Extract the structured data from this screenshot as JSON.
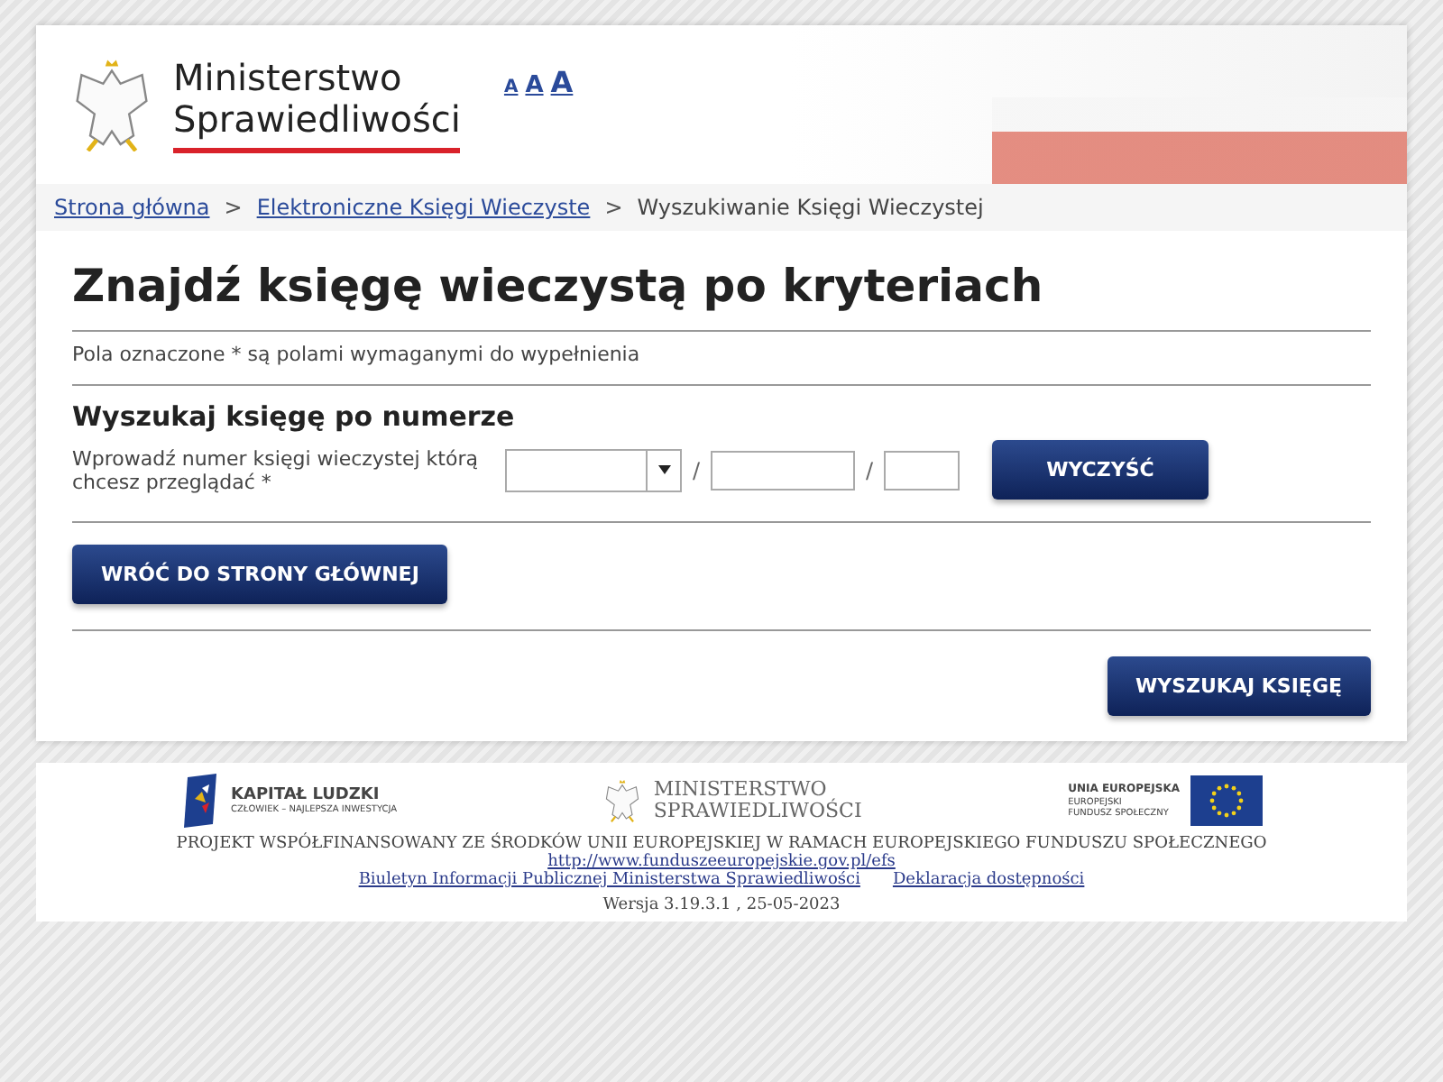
{
  "header": {
    "logo_line_1": "Ministerstwo",
    "logo_line_2": "Sprawiedliwości",
    "font_sizes": [
      "A",
      "A",
      "A"
    ]
  },
  "breadcrumb": [
    {
      "label": "Strona główna",
      "kind": "link"
    },
    {
      "label": "Elektroniczne Księgi Wieczyste",
      "kind": "link"
    },
    {
      "label": "Wyszukiwanie Księgi Wieczystej",
      "kind": "current"
    }
  ],
  "breadcrumb_separator": ">",
  "title": "Znajdź księgę wieczystą po kryteriach",
  "required_note": "Pola oznaczone * są polami wymaganymi do wypełnienia",
  "section": {
    "title": "Wyszukaj księgę po numerze",
    "label": "Wprowadź numer księgi wieczystej którą chcesz przeglądać *",
    "separator": "/",
    "clear_button": "WYCZYŚĆ"
  },
  "back_button": "WRÓĆ DO STRONY GŁÓWNEJ",
  "search_button": "WYSZUKAJ KSIĘGĘ",
  "footer": {
    "kl_title": "KAPITAŁ LUDZKI",
    "kl_subtitle": "CZŁOWIEK – NAJLEPSZA INWESTYCJA",
    "ms_line_1": "MINISTERSTWO",
    "ms_line_2": "SPRAWIEDLIWOŚCI",
    "eu_line_1": "UNIA EUROPEJSKA",
    "eu_line_2": "EUROPEJSKI",
    "eu_line_3": "FUNDUSZ SPOŁECZNY",
    "project": "PROJEKT WSPÓŁFINANSOWANY ZE ŚRODKÓW UNII EUROPEJSKIEJ W RAMACH EUROPEJSKIEGO FUNDUSZU SPOŁECZNEGO",
    "url": "http://www.funduszeeuropejskie.gov.pl/efs",
    "links": [
      "Biuletyn Informacji Publicznej Ministerstwa Sprawiedliwości",
      "Deklaracja dostępności"
    ],
    "version": "Wersja 3.19.3.1 , 25-05-2023"
  }
}
